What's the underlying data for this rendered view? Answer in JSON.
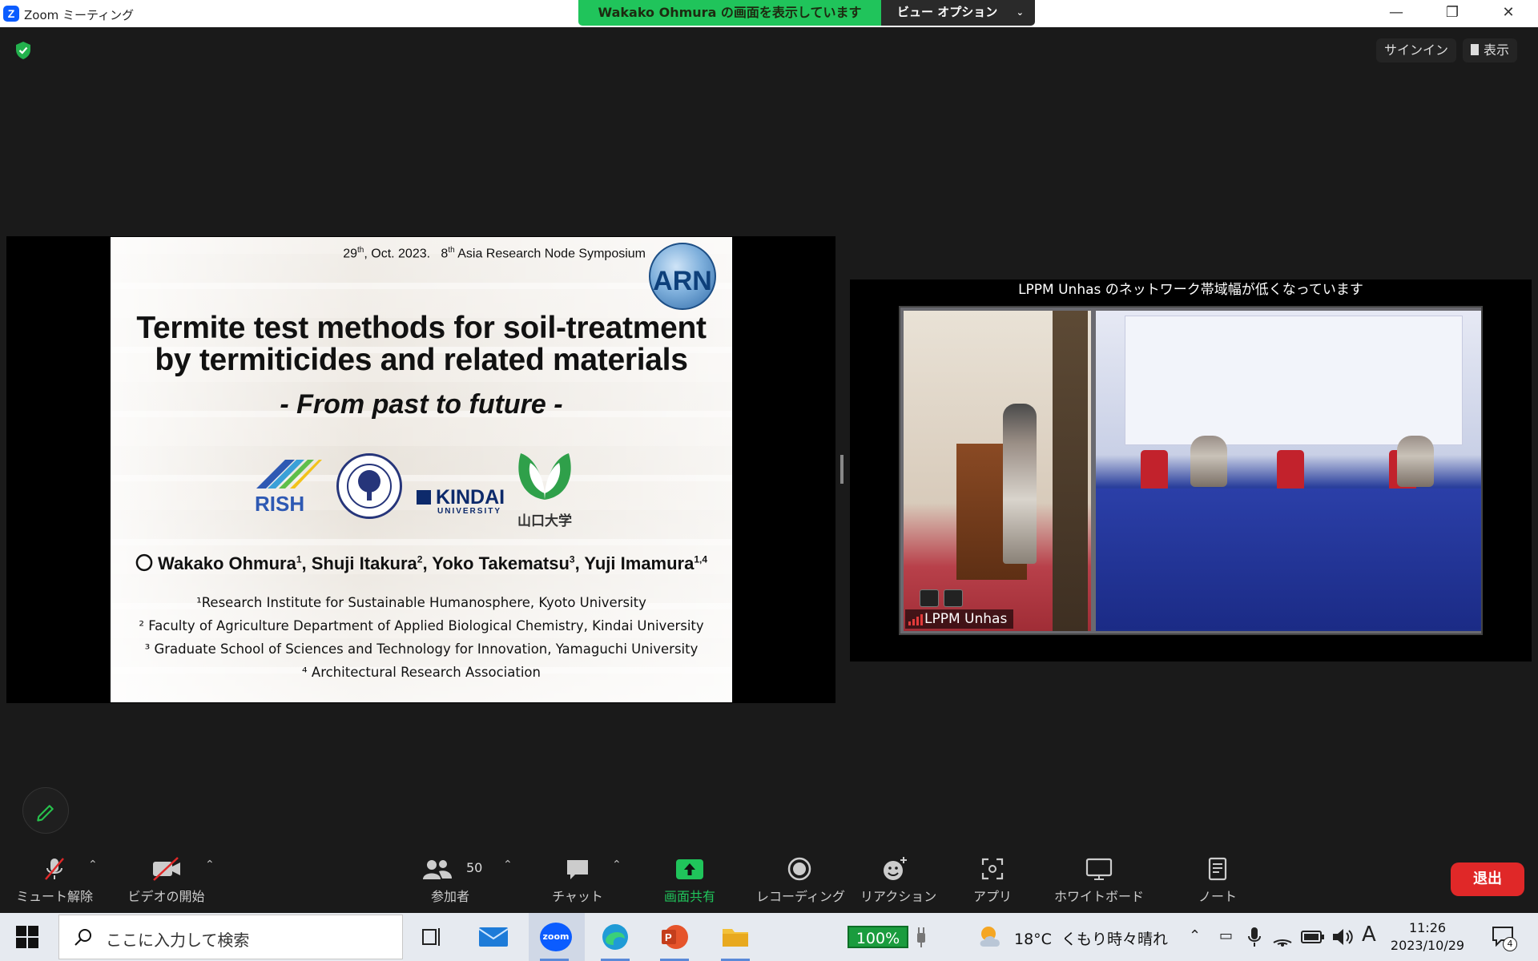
{
  "titlebar": {
    "app_icon": "Z",
    "title": "Zoom ミーティング",
    "share_status": "Wakako  Ohmura の画面を表示しています",
    "view_options": "ビュー オプション"
  },
  "top_right": {
    "signin": "サインイン",
    "view": "表示"
  },
  "slide": {
    "date_day": "29",
    "date_day_sup": "th",
    "date_rest": ", Oct. 2023.",
    "symposium_num": "8",
    "symposium_sup": "th",
    "symposium": "Asia Research Node Symposium",
    "arn_logo": "ARN",
    "title_line1": "Termite test methods for soil-treatment",
    "title_line2": "by termiticides and related materials",
    "subtitle": "- From past to future -",
    "logo_rish": "RISH",
    "logo_kindai": "KINDAI",
    "logo_kindai_sub": "UNIVERSITY",
    "logo_yamaguchi": "山口大学",
    "authors": [
      {
        "name": "〇 Wakako Ohmura",
        "sup": "1"
      },
      {
        "name": ", Shuji Itakura",
        "sup": "2"
      },
      {
        "name": ", Yoko Takematsu",
        "sup": "3"
      },
      {
        "name": ", Yuji Imamura",
        "sup": "1,4"
      }
    ],
    "affiliations": [
      "¹Research Institute for Sustainable Humanosphere, Kyoto University",
      "² Faculty of Agriculture Department of Applied Biological Chemistry, Kindai University",
      "³ Graduate School of Sciences and Technology for Innovation, Yamaguchi University",
      "⁴ Architectural Research Association"
    ]
  },
  "video": {
    "warning": "LPPM Unhas のネットワーク帯域幅が低くなっています",
    "participant": "LPPM Unhas"
  },
  "toolbar": {
    "mute": "ミュート解除",
    "video": "ビデオの開始",
    "participants": "参加者",
    "participant_count": "50",
    "chat": "チャット",
    "share": "画面共有",
    "record": "レコーディング",
    "reactions": "リアクション",
    "apps": "アプリ",
    "whiteboard": "ホワイトボード",
    "notes": "ノート",
    "leave": "退出"
  },
  "taskbar": {
    "search_placeholder": "ここに入力して検索",
    "battery": "100%",
    "temperature": "18°C",
    "weather": "くもり時々晴れ",
    "ime": "A",
    "time": "11:26",
    "date": "2023/10/29",
    "notifications": "4"
  },
  "colors": {
    "accent_green": "#20c45b",
    "leave_red": "#e02828",
    "zoom_blue": "#0b5cff"
  }
}
